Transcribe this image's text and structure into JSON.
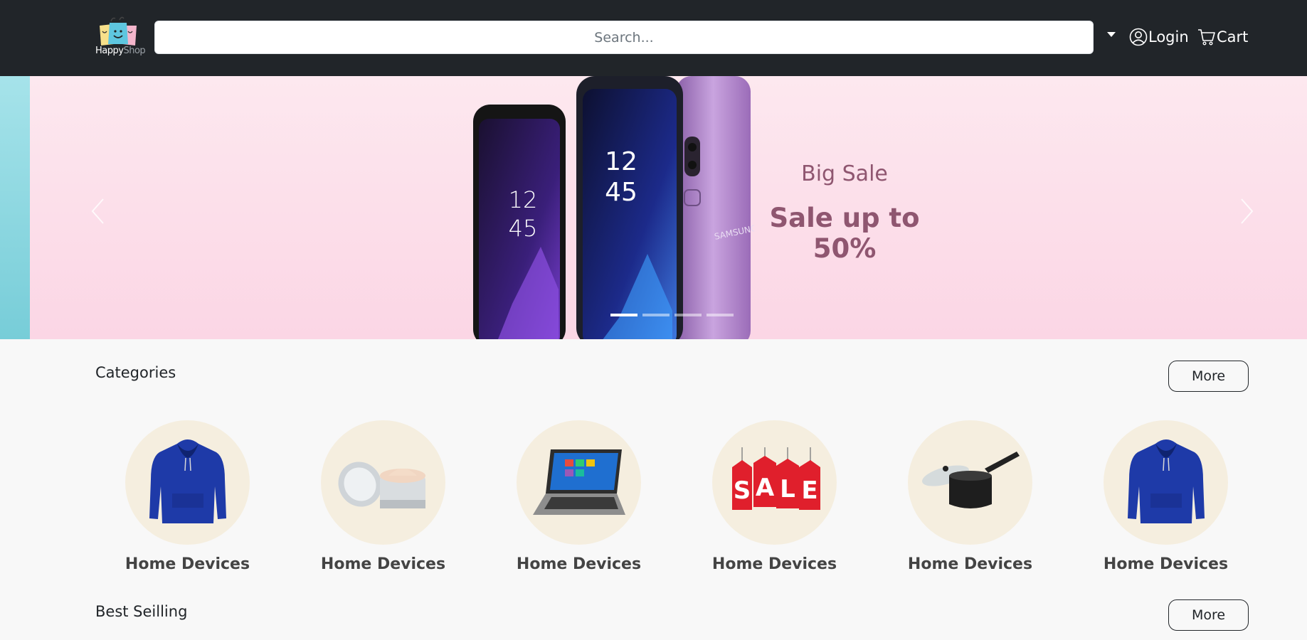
{
  "header": {
    "brand_part1": "Happy",
    "brand_part2": "Shop",
    "search_placeholder": "Search...",
    "login_label": "Login",
    "cart_label": "Cart"
  },
  "carousel": {
    "subtitle": "Big Sale",
    "title": "Sale up to 50%",
    "slide_count": 4,
    "active_slide": 1,
    "phone_screen_time": [
      "12",
      "45"
    ],
    "phone_brand": "SAMSUNG"
  },
  "categories": {
    "title": "Categories",
    "more_label": "More",
    "items": [
      {
        "label": "Home Devices",
        "image": "hoodie-image"
      },
      {
        "label": "Home Devices",
        "image": "cream-jar-image"
      },
      {
        "label": "Home Devices",
        "image": "laptop-image"
      },
      {
        "label": "Home Devices",
        "image": "sale-tags-image",
        "image_text": [
          "S",
          "A",
          "L",
          "E"
        ]
      },
      {
        "label": "Home Devices",
        "image": "saucepan-image"
      },
      {
        "label": "Home Devices",
        "image": "hoodie-image"
      }
    ]
  },
  "best_selling": {
    "title": "Best Seilling",
    "more_label": "More"
  },
  "colors": {
    "navbar": "#212529",
    "carousel_bg": "#fbd6e5",
    "caption": "#8f5670",
    "category_circle": "#f5eedf",
    "accent_strip": "#77cdd8"
  }
}
